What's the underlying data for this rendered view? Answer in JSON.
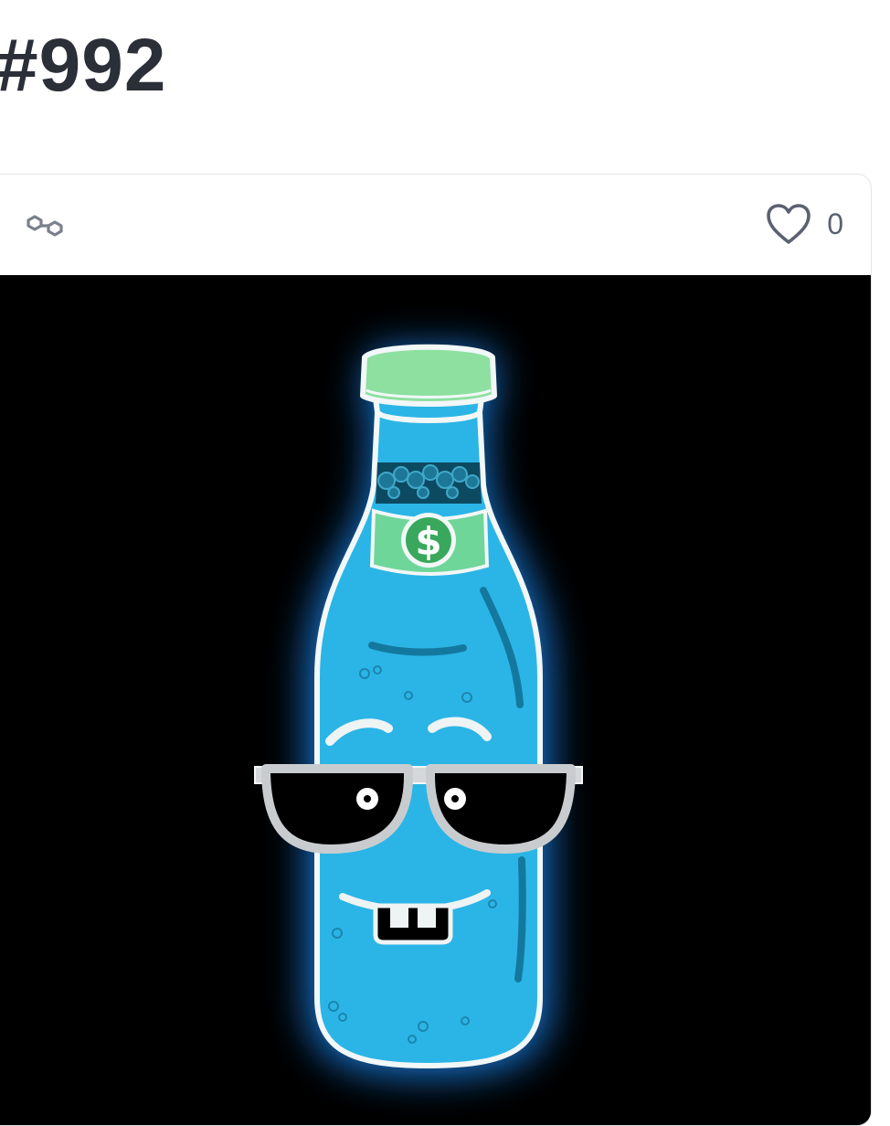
{
  "page": {
    "title": "#992"
  },
  "card": {
    "chain_icon": "polygon-link-icon",
    "favorites": {
      "icon": "heart-outline-icon",
      "count": "0"
    }
  },
  "artwork": {
    "subject": "neon-blue-bottle-with-sunglasses",
    "label_symbol": "$",
    "colors": {
      "background": "#000000",
      "glow": "#1ea0ff",
      "bottle": "#2bb5e6",
      "bottle_shadow": "#14789e",
      "cap": "#8de0a0",
      "label": "#6fd69a",
      "coin": "#3aa85c",
      "outline": "#f2f7f8"
    }
  }
}
